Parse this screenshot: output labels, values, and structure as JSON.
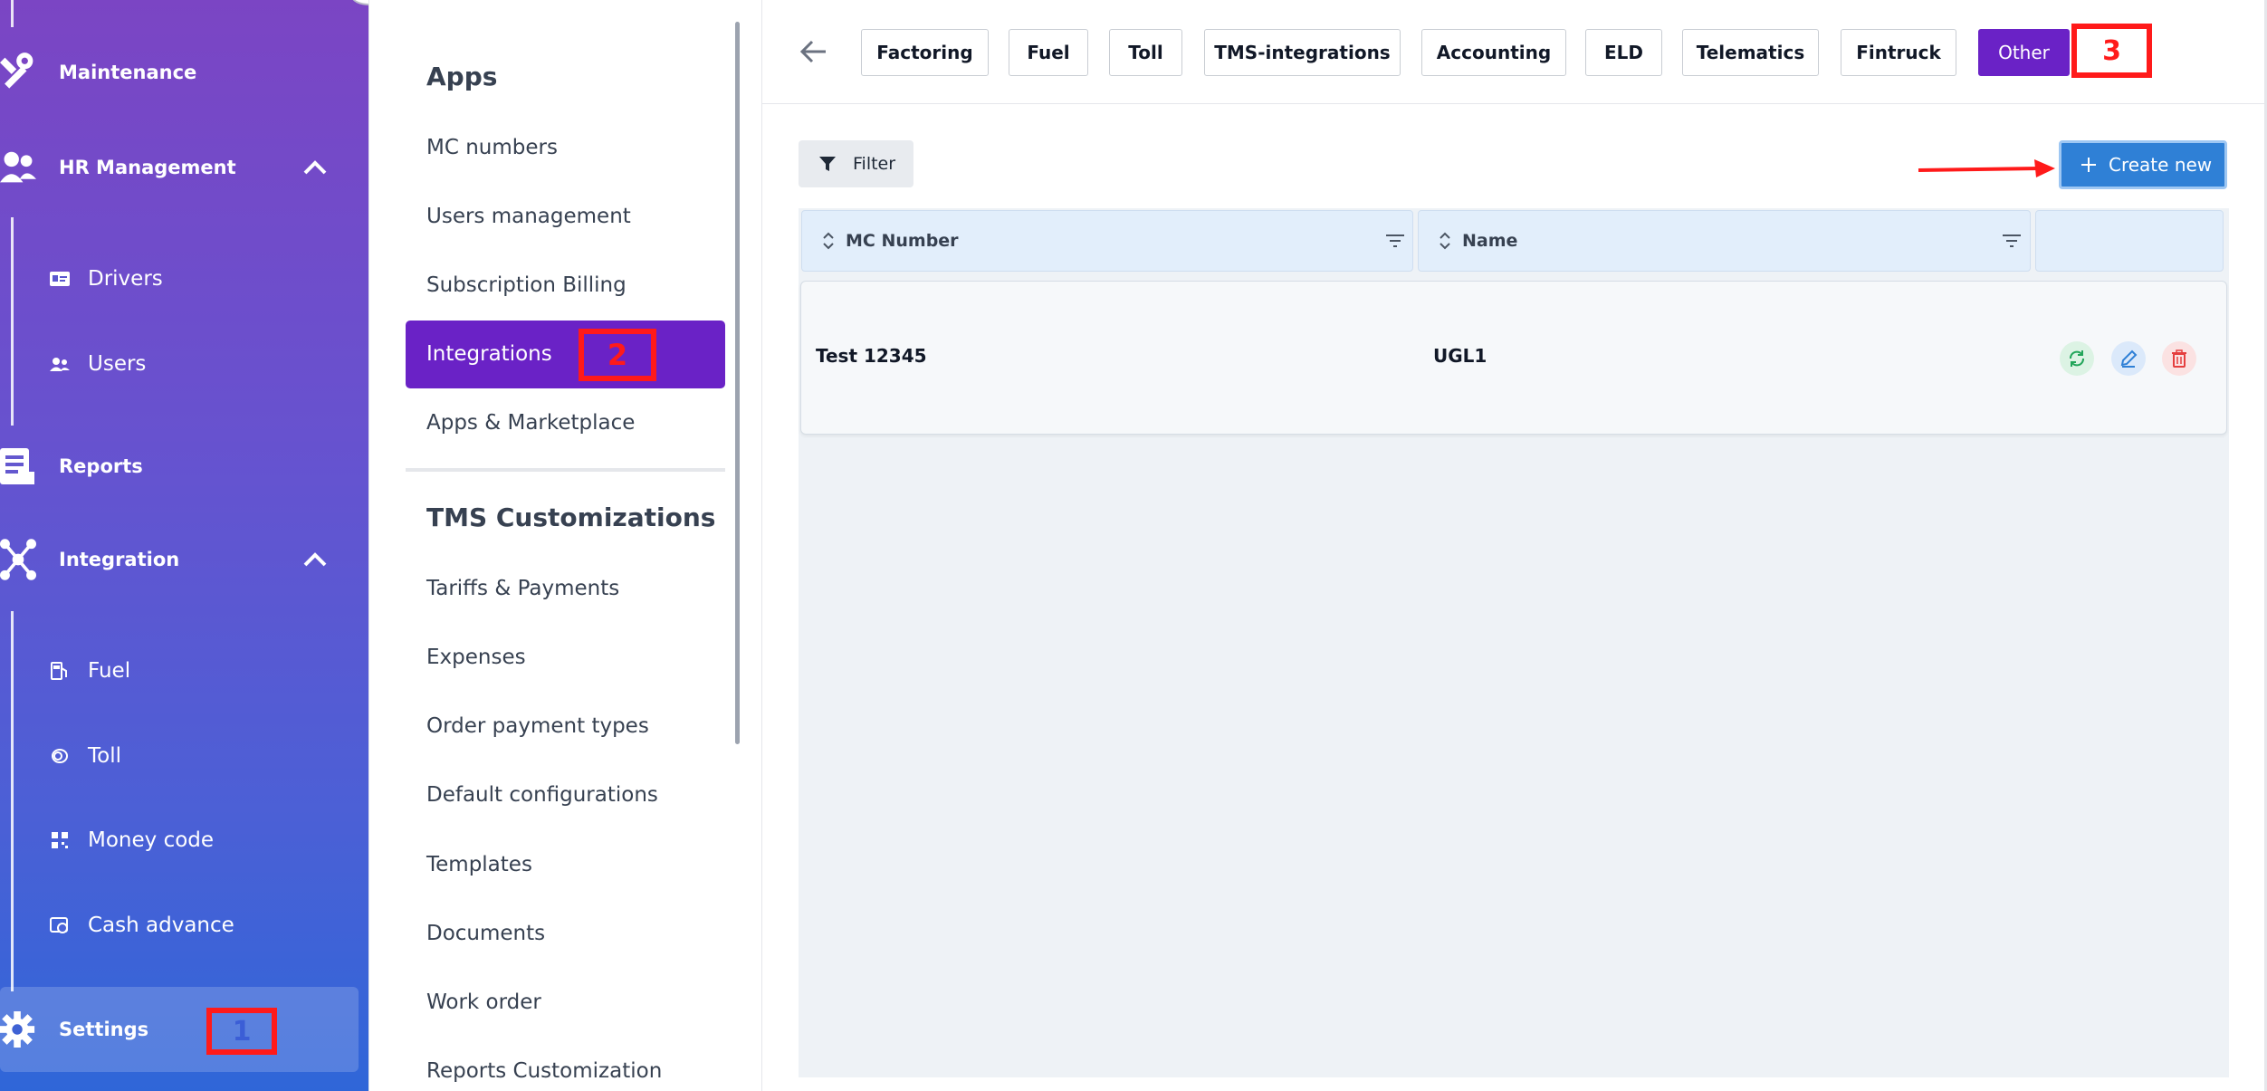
{
  "sidebar": {
    "maintenance": "Maintenance",
    "hr_management": "HR Management",
    "drivers": "Drivers",
    "users": "Users",
    "reports": "Reports",
    "integration": "Integration",
    "fuel": "Fuel",
    "toll": "Toll",
    "money_code": "Money code",
    "cash_advance": "Cash advance",
    "settings": "Settings"
  },
  "settings_menu": {
    "apps_heading": "Apps",
    "apps_items": [
      "MC numbers",
      "Users management",
      "Subscription Billing",
      "Integrations",
      "Apps & Marketplace"
    ],
    "tms_heading": "TMS Customizations",
    "tms_items": [
      "Tariffs & Payments",
      "Expenses",
      "Order payment types",
      "Default configurations",
      "Templates",
      "Documents",
      "Work order",
      "Reports Customization"
    ]
  },
  "tabs": [
    "Factoring",
    "Fuel",
    "Toll",
    "TMS-integrations",
    "Accounting",
    "ELD",
    "Telematics",
    "Fintruck",
    "Other"
  ],
  "active_tab": "Other",
  "toolbar": {
    "filter_label": "Filter",
    "create_label": "Create new"
  },
  "table": {
    "columns": [
      "MC Number",
      "Name",
      ""
    ],
    "rows": [
      {
        "mc_number": "Test 12345",
        "name": "UGL1"
      }
    ]
  },
  "annotations": [
    "1",
    "2",
    "3"
  ],
  "colors": {
    "accent_purple": "#6a22c6",
    "create_blue": "#2f80d6",
    "annotation_red": "#ff1a1a"
  }
}
